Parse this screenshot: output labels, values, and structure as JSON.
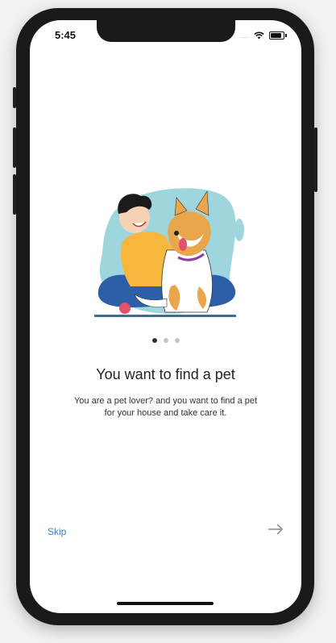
{
  "status_bar": {
    "time": "5:45",
    "cellular": "....."
  },
  "onboarding": {
    "title": "You want to find a pet",
    "description": "You are a pet lover? and you want to find a pet for your house and take care it.",
    "page_count": 3,
    "current_page": 1
  },
  "footer": {
    "skip_label": "Skip",
    "next_icon": "arrow-right-icon"
  },
  "colors": {
    "accent": "#3e7fb5",
    "active_dot": "#1f3557",
    "inactive_dot": "#c4c4c4"
  }
}
